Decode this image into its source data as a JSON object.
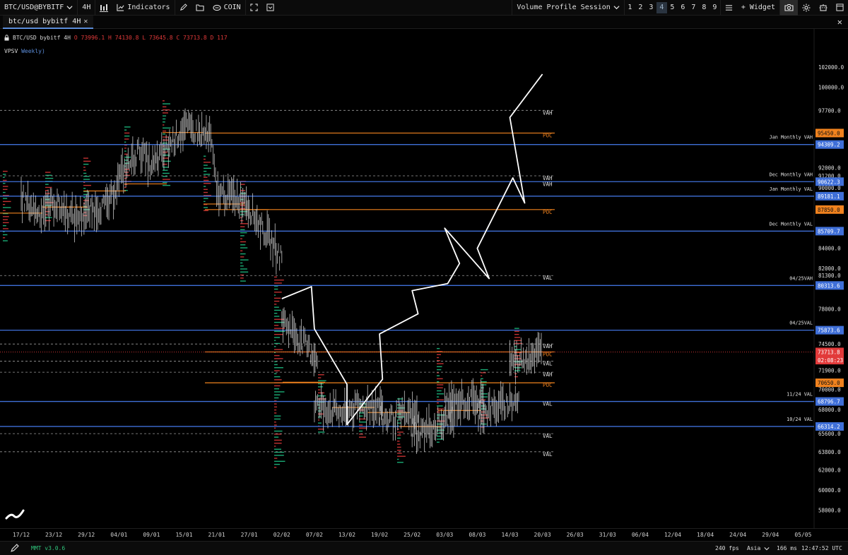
{
  "toolbar": {
    "symbol": "BTC/USD@BYBITF",
    "timeframe": "4H",
    "indicators_label": "Indicators",
    "coin_label": "COIN",
    "session_label": "Volume Profile Session",
    "layouts": [
      "1",
      "2",
      "3",
      "4",
      "5",
      "6",
      "7",
      "8",
      "9"
    ],
    "active_layout": "4",
    "widget_label": "+ Widget"
  },
  "tab": {
    "label": "btc/usd bybitf 4H",
    "close": "✕"
  },
  "pane_close": "✕",
  "legend": {
    "symbol": "BTC/USD bybitf 4H",
    "ohlc": "O 73996.1 H 74130.8 L 73645.8 C 73713.8 D 117"
  },
  "indicator": {
    "name": "VPSV",
    "param": "Weekly)"
  },
  "price_axis": {
    "ticks": [
      "102000.0",
      "100000.0",
      "97700.0",
      "92000.0",
      "91200.0",
      "90000.0",
      "84000.0",
      "82000.0",
      "81300.0",
      "78000.0",
      "74500.0",
      "71900.0",
      "70000.0",
      "68000.0",
      "65600.0",
      "63800.0",
      "62000.0",
      "60000.0",
      "58000.0"
    ],
    "hline_labels": [
      {
        "price": 95450.0,
        "text": "95450.0",
        "color": "#f0821e"
      },
      {
        "price": 94309.2,
        "text": "94309.2",
        "color": "#3f6fd8"
      },
      {
        "price": 90622.3,
        "text": "90622.3",
        "color": "#3f6fd8"
      },
      {
        "price": 89181.1,
        "text": "89181.1",
        "color": "#3f6fd8"
      },
      {
        "price": 87850.0,
        "text": "87850.0",
        "color": "#f0821e"
      },
      {
        "price": 85709.7,
        "text": "85709.7",
        "color": "#3f6fd8"
      },
      {
        "price": 80313.6,
        "text": "80313.6",
        "color": "#3f6fd8"
      },
      {
        "price": 75873.6,
        "text": "75873.6",
        "color": "#3f6fd8"
      },
      {
        "price": 73713.8,
        "text": "73713.8",
        "color": "#e23a3a"
      },
      {
        "price": 72900.0,
        "text": "02:08:23",
        "color": "#e23a3a"
      },
      {
        "price": 70650.0,
        "text": "70650.0",
        "color": "#f0821e"
      },
      {
        "price": 68796.7,
        "text": "68796.7",
        "color": "#3f6fd8"
      },
      {
        "price": 66314.2,
        "text": "66314.2",
        "color": "#3f6fd8"
      }
    ]
  },
  "levels": [
    {
      "price": 94309.2,
      "label": "Jan Monthly VAH"
    },
    {
      "price": 90622.3,
      "label": "Dec Monthly VAH"
    },
    {
      "price": 89181.1,
      "label": "Jan Monthly VAL"
    },
    {
      "price": 85709.7,
      "label": "Dec Monthly VAL"
    },
    {
      "price": 80313.6,
      "label": "04/25VAH"
    },
    {
      "price": 75873.6,
      "label": "04/25VAL"
    },
    {
      "price": 68796.7,
      "label": "11/24 VAL"
    },
    {
      "price": 66314.2,
      "label": "10/24 VAL"
    }
  ],
  "profile_labels": [
    {
      "price": 97700.0,
      "text": "VAH",
      "kind": "dash"
    },
    {
      "price": 95450.0,
      "text": "POC",
      "kind": "poc"
    },
    {
      "price": 91200.0,
      "text": "VAH",
      "kind": "dash"
    },
    {
      "price": 90622.3,
      "text": "VAH",
      "kind": "none"
    },
    {
      "price": 87850.0,
      "text": "POC",
      "kind": "poc"
    },
    {
      "price": 81300.0,
      "text": "VAL",
      "kind": "dash"
    },
    {
      "price": 74500.0,
      "text": "VAH",
      "kind": "dash"
    },
    {
      "price": 73713.8,
      "text": "POC",
      "kind": "poc"
    },
    {
      "price": 72800.0,
      "text": "VAL",
      "kind": "dash"
    },
    {
      "price": 71700.0,
      "text": "VAH",
      "kind": "dash"
    },
    {
      "price": 70650.0,
      "text": "POC",
      "kind": "poc"
    },
    {
      "price": 68800.0,
      "text": "VAL",
      "kind": "none"
    },
    {
      "price": 65600.0,
      "text": "VAL",
      "kind": "dash"
    },
    {
      "price": 63800.0,
      "text": "VAL",
      "kind": "dash"
    }
  ],
  "x_axis": [
    "17/12",
    "23/12",
    "29/12",
    "04/01",
    "09/01",
    "15/01",
    "21/01",
    "27/01",
    "02/02",
    "07/02",
    "13/02",
    "19/02",
    "25/02",
    "03/03",
    "08/03",
    "14/03",
    "20/03",
    "26/03",
    "31/03",
    "06/04",
    "12/04",
    "18/04",
    "24/04",
    "29/04",
    "05/05"
  ],
  "status": {
    "version": "MMT v3.0.6",
    "fps": "240 fps",
    "region": "Asia",
    "latency": "166 ms",
    "clock": "12:47:52 UTC"
  },
  "colors": {
    "background": "#000000",
    "monthly_level": "#3f6fd8",
    "poc": "#f0821e",
    "last_price": "#e23a3a",
    "bull_volume": "#1fc98a",
    "bear_volume": "#e23a3a",
    "candles": "#cfcfcf",
    "projection": "#ffffff"
  },
  "chart_data": {
    "type": "line",
    "title": "BTC/USD bybitf 4H",
    "ylim": [
      57000,
      104000
    ],
    "x_range": [
      "17/12",
      "05/05"
    ],
    "series": [
      {
        "x": [
          "17/12",
          "20/12",
          "23/12",
          "26/12",
          "29/12",
          "01/01",
          "04/01",
          "06/01",
          "09/01",
          "12/01",
          "15/01",
          "18/01",
          "21/01",
          "24/01",
          "27/01",
          "30/01",
          "02/02",
          "05/02",
          "07/02",
          "10/02",
          "13/02",
          "16/02",
          "19/02",
          "22/02",
          "25/02",
          "28/02",
          "03/03",
          "05/03",
          "08/03",
          "11/03",
          "14/03",
          "15/03"
        ],
        "values": [
          89000,
          87500,
          88500,
          87000,
          87500,
          88500,
          91000,
          93800,
          92000,
          95000,
          96000,
          95000,
          89500,
          88800,
          88000,
          83000,
          77000,
          73000,
          68500,
          67500,
          68000,
          68500,
          67000,
          67500,
          65500,
          67000,
          68500,
          69000,
          67500,
          69000,
          72800,
          73713.8
        ]
      },
      {
        "x": [
          "02/02",
          "04/02",
          "07/02",
          "10/02",
          "13/02",
          "16/02",
          "19/02",
          "22/02",
          "25/02",
          "27/02",
          "01/03",
          "03/03",
          "06/03",
          "08/03",
          "10/03",
          "12/03",
          "14/03",
          "15/03"
        ],
        "values": [
          79000,
          80200,
          76000,
          70500,
          66500,
          71000,
          75500,
          77500,
          79800,
          80500,
          82500,
          86000,
          81000,
          84000,
          91000,
          88500,
          97000,
          101300
        ]
      }
    ]
  }
}
